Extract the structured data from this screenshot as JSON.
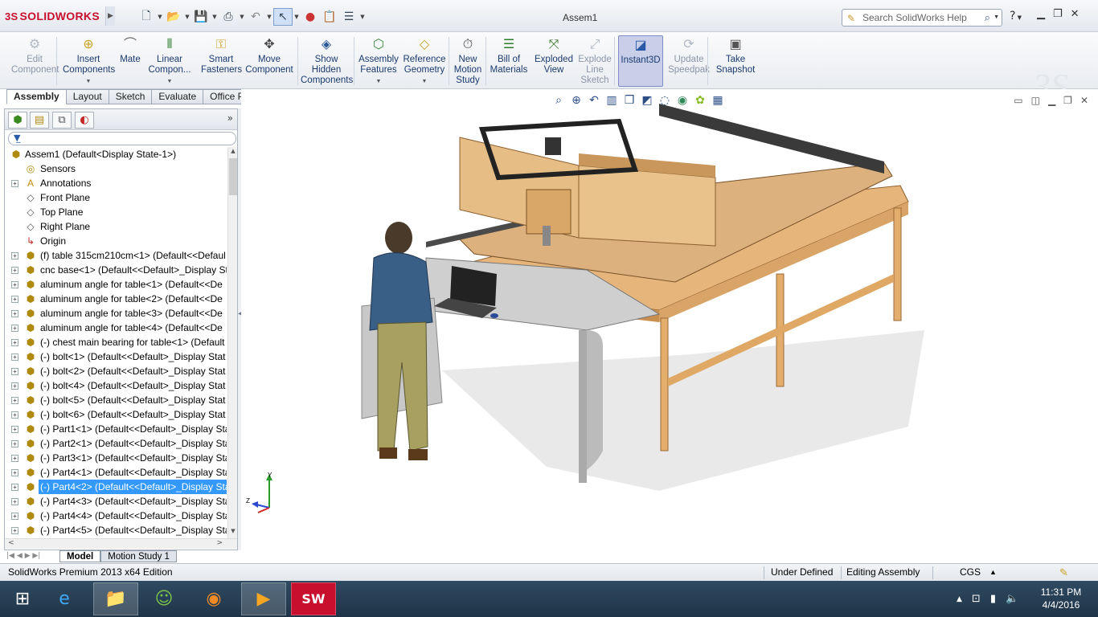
{
  "titlebar": {
    "logo_text": "SOLIDWORKS",
    "logo_prefix": "3S",
    "document_title": "Assem1",
    "search_placeholder": "Search SolidWorks Help",
    "help_icon": "?"
  },
  "ribbon": {
    "buttons": [
      {
        "label": "Edit Component",
        "icon": "edit-component-icon",
        "enabled": false
      },
      {
        "label": "Insert Components",
        "icon": "insert-components-icon",
        "enabled": true
      },
      {
        "label": "Mate",
        "icon": "mate-icon",
        "enabled": true
      },
      {
        "label": "Linear Compon...",
        "icon": "linear-pattern-icon",
        "enabled": true
      },
      {
        "label": "Smart Fasteners",
        "icon": "smart-fasteners-icon",
        "enabled": true
      },
      {
        "label": "Move Component",
        "icon": "move-component-icon",
        "enabled": true
      },
      {
        "label": "Show Hidden Components",
        "icon": "show-hidden-icon",
        "enabled": true
      },
      {
        "label": "Assembly Features",
        "icon": "assembly-features-icon",
        "enabled": true
      },
      {
        "label": "Reference Geometry",
        "icon": "reference-geometry-icon",
        "enabled": true
      },
      {
        "label": "New Motion Study",
        "icon": "motion-study-icon",
        "enabled": true
      },
      {
        "label": "Bill of Materials",
        "icon": "bom-icon",
        "enabled": true
      },
      {
        "label": "Exploded View",
        "icon": "exploded-view-icon",
        "enabled": true
      },
      {
        "label": "Explode Line Sketch",
        "icon": "explode-line-icon",
        "enabled": false
      },
      {
        "label": "Instant3D",
        "icon": "instant3d-icon",
        "enabled": true,
        "active": true
      },
      {
        "label": "Update Speedpak",
        "icon": "speedpak-icon",
        "enabled": false
      },
      {
        "label": "Take Snapshot",
        "icon": "snapshot-icon",
        "enabled": true
      }
    ]
  },
  "command_tabs": [
    {
      "label": "Assembly",
      "active": true
    },
    {
      "label": "Layout",
      "active": false
    },
    {
      "label": "Sketch",
      "active": false
    },
    {
      "label": "Evaluate",
      "active": false
    },
    {
      "label": "Office Products",
      "active": false
    }
  ],
  "feature_tree": {
    "root": "Assem1  (Default<Display State-1>)",
    "items": [
      {
        "label": "Sensors",
        "kind": "sensor",
        "expander": false
      },
      {
        "label": "Annotations",
        "kind": "annotation",
        "expander": true
      },
      {
        "label": "Front Plane",
        "kind": "plane",
        "expander": false
      },
      {
        "label": "Top Plane",
        "kind": "plane",
        "expander": false
      },
      {
        "label": "Right Plane",
        "kind": "plane",
        "expander": false
      },
      {
        "label": "Origin",
        "kind": "origin",
        "expander": false
      },
      {
        "label": "(f) table 315cm210cm<1> (Default<<Defaul",
        "kind": "part",
        "expander": true
      },
      {
        "label": "cnc base<1> (Default<<Default>_Display St",
        "kind": "part",
        "expander": true
      },
      {
        "label": "aluminum angle for table<1> (Default<<De",
        "kind": "part",
        "expander": true
      },
      {
        "label": "aluminum angle for table<2> (Default<<De",
        "kind": "part",
        "expander": true
      },
      {
        "label": "aluminum angle for table<3> (Default<<De",
        "kind": "part",
        "expander": true
      },
      {
        "label": "aluminum angle for table<4> (Default<<De",
        "kind": "part",
        "expander": true
      },
      {
        "label": "(-) chest main bearing for table<1> (Default",
        "kind": "part",
        "expander": true
      },
      {
        "label": "(-) bolt<1> (Default<<Default>_Display Stat",
        "kind": "part",
        "expander": true
      },
      {
        "label": "(-) bolt<2> (Default<<Default>_Display Stat",
        "kind": "part",
        "expander": true
      },
      {
        "label": "(-) bolt<4> (Default<<Default>_Display Stat",
        "kind": "part",
        "expander": true
      },
      {
        "label": "(-) bolt<5> (Default<<Default>_Display Stat",
        "kind": "part",
        "expander": true
      },
      {
        "label": "(-) bolt<6> (Default<<Default>_Display Stat",
        "kind": "part",
        "expander": true
      },
      {
        "label": "(-) Part1<1> (Default<<Default>_Display Sta",
        "kind": "part",
        "expander": true
      },
      {
        "label": "(-) Part2<1> (Default<<Default>_Display Sta",
        "kind": "part",
        "expander": true
      },
      {
        "label": "(-) Part3<1> (Default<<Default>_Display Sta",
        "kind": "part",
        "expander": true
      },
      {
        "label": "(-) Part4<1> (Default<<Default>_Display Sta",
        "kind": "part",
        "expander": true
      },
      {
        "label": "(-) Part4<2> (Default<<Default>_Display Sta",
        "kind": "part",
        "expander": true,
        "selected": true
      },
      {
        "label": "(-) Part4<3> (Default<<Default>_Display Sta",
        "kind": "part",
        "expander": true
      },
      {
        "label": "(-) Part4<4> (Default<<Default>_Display Sta",
        "kind": "part",
        "expander": true
      },
      {
        "label": "(-) Part4<5> (Default<<Default>_Display Sta",
        "kind": "part",
        "expander": true
      }
    ]
  },
  "bottom_tabs": [
    {
      "label": "Model",
      "active": true
    },
    {
      "label": "Motion Study 1",
      "active": false
    }
  ],
  "triad": {
    "x": "X",
    "y": "Y",
    "z": "Z"
  },
  "statusbar": {
    "edition": "SolidWorks Premium 2013 x64 Edition",
    "definition": "Under Defined",
    "mode": "Editing Assembly",
    "units": "CGS"
  },
  "taskbar": {
    "time": "11:31 PM",
    "date": "4/4/2016",
    "apps": [
      "start-icon",
      "internet-explorer-icon",
      "file-explorer-icon",
      "messenger-icon",
      "firefox-icon",
      "media-player-icon",
      "solidworks-icon"
    ]
  },
  "colors": {
    "selection": "#3399ff",
    "wood": "#e0b57a",
    "accent_red": "#c8102e"
  }
}
